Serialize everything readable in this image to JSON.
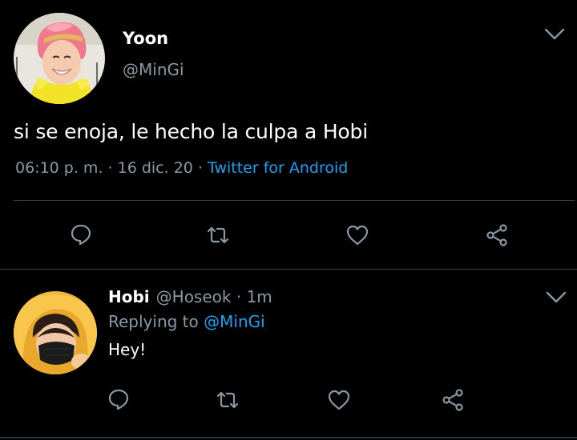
{
  "main_tweet": {
    "author_name": "Yoon",
    "author_handle": "@MinGi",
    "text": "si se enoja, le hecho la culpa a Hobi",
    "time": "06:10 p. m.",
    "date": "16 dic. 20",
    "separator": " · ",
    "source": "Twitter for Android",
    "actions": [
      "reply-icon",
      "retweet-icon",
      "like-icon",
      "share-icon"
    ]
  },
  "reply_tweet": {
    "author_name": "Hobi",
    "author_handle": "@Hoseok",
    "age": "1m",
    "header_separator": " · ",
    "replying_prefix": "Replying to ",
    "replying_to": "@MinGi",
    "text": "Hey!",
    "actions": [
      "reply-icon",
      "retweet-icon",
      "like-icon",
      "share-icon"
    ]
  },
  "colors": {
    "background": "#000000",
    "secondary_text": "#8899a6",
    "link": "#1da1f2",
    "divider": "#38444d"
  }
}
